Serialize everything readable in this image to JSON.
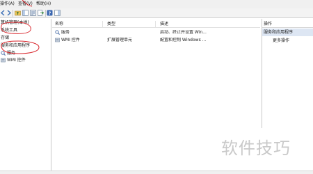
{
  "menubar": {
    "items": [
      {
        "label": "操作(A)"
      },
      {
        "label": "查看(V)"
      },
      {
        "label": "帮助(H)"
      }
    ]
  },
  "toolbar": {
    "buttons": [
      {
        "icon": "back-icon"
      },
      {
        "icon": "forward-icon"
      },
      {
        "icon": "up-folder-icon"
      },
      {
        "icon": "show-hide-tree-icon"
      },
      {
        "icon": "properties-icon"
      },
      {
        "icon": "export-list-icon"
      },
      {
        "icon": "help-icon"
      },
      {
        "icon": "show-hide-action-pane-icon"
      }
    ]
  },
  "tree": {
    "items": [
      {
        "label": "算机管理(本地)",
        "icon": "computer-icon"
      },
      {
        "label": "系统工具",
        "icon": "tools-icon"
      },
      {
        "label": "存储",
        "icon": "storage-icon"
      },
      {
        "label": "服务和应用程序",
        "icon": "services-apps-icon"
      },
      {
        "label": "服务",
        "icon": "services-icon"
      },
      {
        "label": "WMI 控件",
        "icon": "wmi-icon"
      }
    ]
  },
  "list": {
    "columns": [
      "名称",
      "类型",
      "描述"
    ],
    "rows": [
      {
        "name": "服务",
        "type": "",
        "description": "启动、终止并设置 Win...",
        "icon": "services-icon"
      },
      {
        "name": "WMI 控件",
        "type": "扩展管理单元",
        "description": "配置和控制 Windows ...",
        "icon": "wmi-icon"
      }
    ]
  },
  "actions": {
    "title": "操作",
    "section": "服务和应用程序",
    "items": [
      "更多操作"
    ]
  },
  "watermark": "软件技巧",
  "colors": {
    "annotation": "#d9262c",
    "selection": "#dde6f3",
    "chrome": "#f0f0f0"
  }
}
